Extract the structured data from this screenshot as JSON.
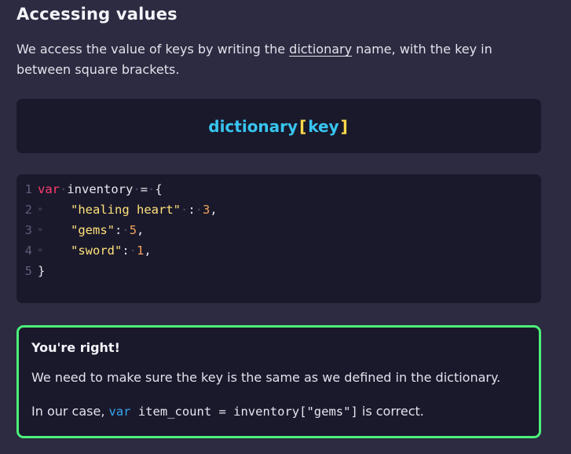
{
  "lesson": {
    "heading": "Accessing values",
    "intro": {
      "before": "We access the value of keys by writing the ",
      "term": "dictionary",
      "after": " name, with the key in between square brackets."
    }
  },
  "syntax": {
    "dictionary": "dictionary",
    "open_bracket": "[",
    "key": "key",
    "close_bracket": "]"
  },
  "code": {
    "lines": [
      {
        "number": "1",
        "indent": ""
      },
      {
        "number": "2",
        "indent": "»"
      },
      {
        "number": "3",
        "indent": "»"
      },
      {
        "number": "4",
        "indent": "»"
      },
      {
        "number": "5",
        "indent": ""
      }
    ],
    "line1": {
      "keyword": "var",
      "name": "inventory",
      "operator": "=",
      "brace": "{"
    },
    "line2": {
      "string": "\"healing heart\"",
      "colon": ":",
      "number": "3",
      "comma": ","
    },
    "line3": {
      "string": "\"gems\"",
      "colon": ":",
      "number": "5",
      "comma": ","
    },
    "line4": {
      "string": "\"sword\"",
      "colon": ":",
      "number": "1",
      "comma": ","
    },
    "line5": {
      "brace": "}"
    }
  },
  "feedback": {
    "title": "You're right!",
    "message": "We need to make sure the key is the same as we defined in the dictionary.",
    "case_before": "In our case, ",
    "case_keyword": "var",
    "case_code": " item_count = inventory[\"gems\"]",
    "case_after": " is correct.",
    "border_color": "#4cf07a"
  }
}
